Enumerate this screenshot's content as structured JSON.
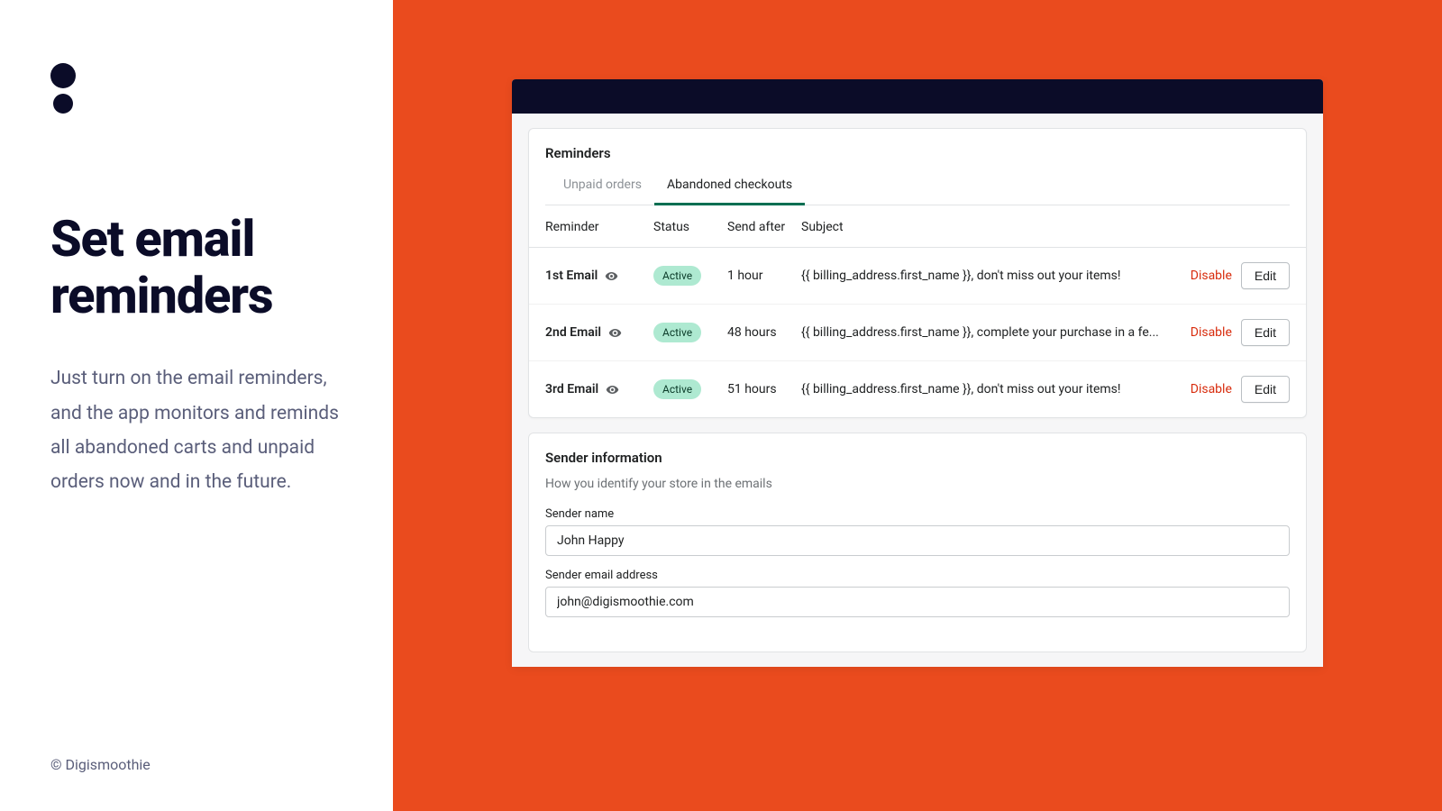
{
  "hero": {
    "title": "Set email reminders",
    "description": "Just turn on the email reminders, and the app monitors and reminds all abandoned carts and unpaid orders now and in the future.",
    "footer": "© Digismoothie"
  },
  "card": {
    "title": "Reminders",
    "tabs": [
      {
        "label": "Unpaid orders",
        "active": false
      },
      {
        "label": "Abandoned checkouts",
        "active": true
      }
    ]
  },
  "table": {
    "headers": {
      "reminder": "Reminder",
      "status": "Status",
      "send_after": "Send after",
      "subject": "Subject"
    },
    "rows": [
      {
        "name": "1st Email",
        "status": "Active",
        "send_after": "1 hour",
        "subject": "{{ billing_address.first_name }}, don't miss out your items!",
        "disable": "Disable",
        "edit": "Edit"
      },
      {
        "name": "2nd Email",
        "status": "Active",
        "send_after": "48 hours",
        "subject": "{{ billing_address.first_name }}, complete your purchase in a fe...",
        "disable": "Disable",
        "edit": "Edit"
      },
      {
        "name": "3rd Email",
        "status": "Active",
        "send_after": "51 hours",
        "subject": "{{ billing_address.first_name }}, don't miss out your items!",
        "disable": "Disable",
        "edit": "Edit"
      }
    ]
  },
  "sender": {
    "title": "Sender information",
    "subtitle": "How you identify your store in the emails",
    "name_label": "Sender name",
    "name_value": "John Happy",
    "email_label": "Sender email address",
    "email_value": "john@digismoothie.com"
  }
}
